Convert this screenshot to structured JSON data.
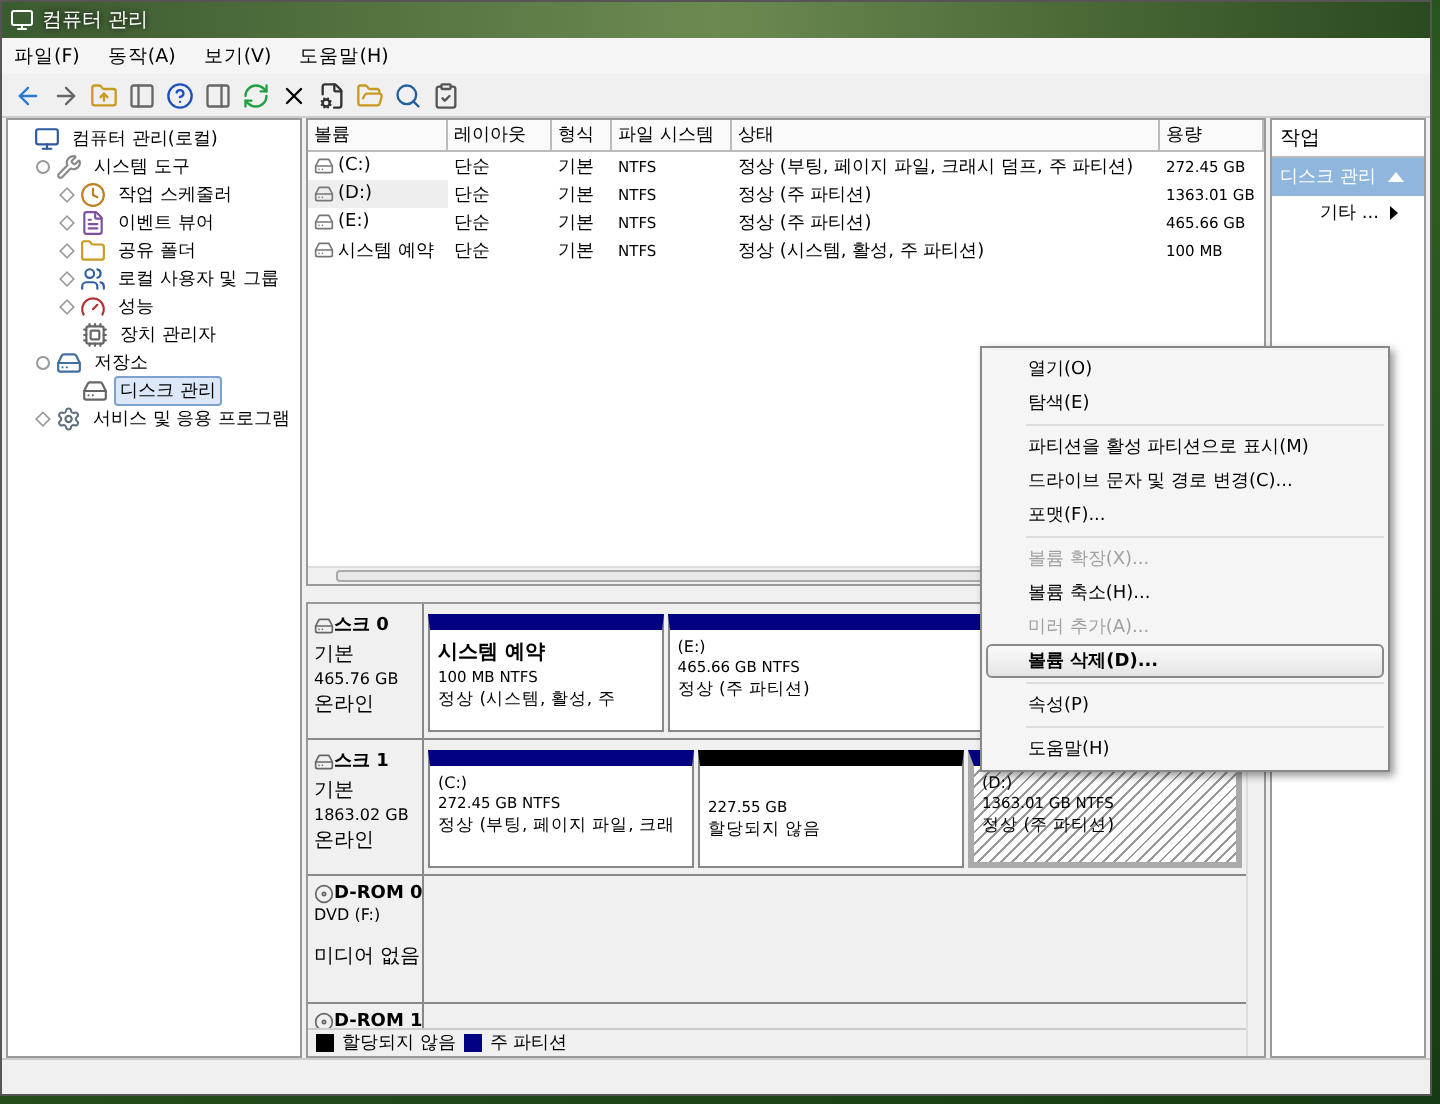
{
  "window": {
    "title": "컴퓨터 관리"
  },
  "menu": [
    "파일(F)",
    "동작(A)",
    "보기(V)",
    "도움말(H)"
  ],
  "tree": [
    {
      "label": "컴퓨터 관리(로컬)",
      "selected": false,
      "children": [
        {
          "label": "시스템 도구",
          "expanded": true,
          "selected": false,
          "children": [
            {
              "label": "작업 스케줄러",
              "expanded": false,
              "selected": false
            },
            {
              "label": "이벤트 뷰어",
              "expanded": false,
              "selected": false
            },
            {
              "label": "공유 폴더",
              "expanded": false,
              "selected": false
            },
            {
              "label": "로컬 사용자 및 그룹",
              "expanded": false,
              "selected": false
            },
            {
              "label": "성능",
              "expanded": false,
              "selected": false
            },
            {
              "label": "장치 관리자",
              "selected": false
            }
          ]
        },
        {
          "label": "저장소",
          "expanded": true,
          "selected": false,
          "children": [
            {
              "label": "디스크 관리",
              "selected": true
            }
          ]
        },
        {
          "label": "서비스 및 응용 프로그램",
          "expanded": false,
          "selected": false
        }
      ]
    }
  ],
  "volume_table": {
    "columns": [
      "볼륨",
      "레이아웃",
      "형식",
      "파일 시스템",
      "상태",
      "용량"
    ],
    "rows": [
      {
        "cells": [
          "(C:)",
          "단순",
          "기본",
          "NTFS",
          "정상 (부팅, 페이지 파일, 크래시 덤프, 주 파티션)",
          "272.45 GB"
        ],
        "selected": false
      },
      {
        "cells": [
          "(D:)",
          "단순",
          "기본",
          "NTFS",
          "정상 (주 파티션)",
          "1363.01 GB"
        ],
        "selected": true
      },
      {
        "cells": [
          "(E:)",
          "단순",
          "기본",
          "NTFS",
          "정상 (주 파티션)",
          "465.66 GB"
        ],
        "selected": false
      },
      {
        "cells": [
          "시스템 예약",
          "단순",
          "기본",
          "NTFS",
          "정상 (시스템, 활성, 주 파티션)",
          "100 MB"
        ],
        "selected": false
      }
    ]
  },
  "disks": [
    {
      "kind": "disk",
      "name": "스크 0",
      "type": "기본",
      "size": "465.76 GB",
      "status": "온라인",
      "partitions": [
        {
          "title": "시스템 예약",
          "size": "100 MB NTFS",
          "status": "정상 (시스템, 활성, 주",
          "kind": "primary",
          "selected": false
        },
        {
          "title": "(E:)",
          "size": "465.66 GB NTFS",
          "status": "정상 (주 파티션)",
          "kind": "primary",
          "selected": false
        }
      ]
    },
    {
      "kind": "disk",
      "name": "스크 1",
      "type": "기본",
      "size": "1863.02 GB",
      "status": "온라인",
      "partitions": [
        {
          "title": "(C:)",
          "size": "272.45 GB NTFS",
          "status": "정상 (부팅, 페이지 파일, 크래",
          "kind": "primary",
          "selected": false
        },
        {
          "size": "227.55 GB",
          "status": "할당되지 않음",
          "kind": "unallocated",
          "selected": false
        },
        {
          "title": "(D:)",
          "size": "1363.01 GB NTFS",
          "status": "정상 (주 파티션)",
          "kind": "primary",
          "selected": true
        }
      ]
    },
    {
      "kind": "cdrom",
      "name": "D-ROM 0",
      "type": "DVD (F:)",
      "status": "미디어 없음"
    },
    {
      "kind": "cdrom",
      "name": "D-ROM 1"
    }
  ],
  "legend": [
    {
      "label": "할당되지 않음",
      "color": "#000000"
    },
    {
      "label": "주 파티션",
      "color": "#000080"
    }
  ],
  "actions": {
    "title": "작업",
    "section": "디스크 관리",
    "items": [
      "기타 ..."
    ]
  },
  "context_menu": [
    {
      "kind": "item",
      "label": "열기(O)",
      "disabled": false,
      "selected": false
    },
    {
      "kind": "item",
      "label": "탐색(E)",
      "disabled": false,
      "selected": false
    },
    {
      "kind": "separator"
    },
    {
      "kind": "item",
      "label": "파티션을 활성 파티션으로 표시(M)",
      "disabled": false,
      "selected": false
    },
    {
      "kind": "item",
      "label": "드라이브 문자 및 경로 변경(C)...",
      "disabled": false,
      "selected": false
    },
    {
      "kind": "item",
      "label": "포맷(F)...",
      "disabled": false,
      "selected": false
    },
    {
      "kind": "separator"
    },
    {
      "kind": "item",
      "label": "볼륨 확장(X)...",
      "disabled": true,
      "selected": false
    },
    {
      "kind": "item",
      "label": "볼륨 축소(H)...",
      "disabled": false,
      "selected": false
    },
    {
      "kind": "item",
      "label": "미러 추가(A)...",
      "disabled": true,
      "selected": false
    },
    {
      "kind": "item",
      "label": "볼륨 삭제(D)...",
      "disabled": false,
      "selected": true
    },
    {
      "kind": "separator"
    },
    {
      "kind": "item",
      "label": "속성(P)",
      "disabled": false,
      "selected": false
    },
    {
      "kind": "separator"
    },
    {
      "kind": "item",
      "label": "도움말(H)",
      "disabled": false,
      "selected": false
    }
  ]
}
